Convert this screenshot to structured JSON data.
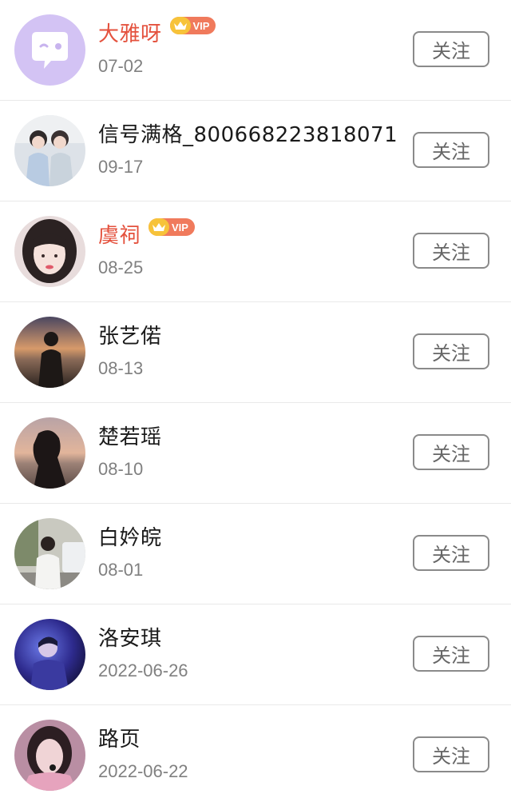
{
  "users": [
    {
      "name": "大雅呀",
      "vip": true,
      "vip_label": "VIP",
      "date": "07-02",
      "button": "关注",
      "avatar_icon": "chat-bubble-face-icon"
    },
    {
      "name": "信号满格_800668223818071",
      "vip": false,
      "date": "09-17",
      "button": "关注",
      "avatar_icon": "couple-photo"
    },
    {
      "name": "虞祠",
      "vip": true,
      "vip_label": "VIP",
      "date": "08-25",
      "button": "关注",
      "avatar_icon": "girl-portrait-photo"
    },
    {
      "name": "张艺偌",
      "vip": false,
      "date": "08-13",
      "button": "关注",
      "avatar_icon": "sunset-silhouette-photo"
    },
    {
      "name": "楚若瑶",
      "vip": false,
      "date": "08-10",
      "button": "关注",
      "avatar_icon": "beach-silhouette-photo"
    },
    {
      "name": "白妗皖",
      "vip": false,
      "date": "08-01",
      "button": "关注",
      "avatar_icon": "street-boy-photo"
    },
    {
      "name": "洛安琪",
      "vip": false,
      "date": "2022-06-26",
      "button": "关注",
      "avatar_icon": "stage-blue-photo"
    },
    {
      "name": "路页",
      "vip": false,
      "date": "2022-06-22",
      "button": "关注",
      "avatar_icon": "singer-pink-photo"
    }
  ],
  "colors": {
    "vip_name": "#e4513d",
    "vip_badge": "#f07a5c",
    "crown": "#f7c33a",
    "date": "#808080",
    "button_border": "#8a8a8a",
    "divider": "#e9e9e9"
  }
}
